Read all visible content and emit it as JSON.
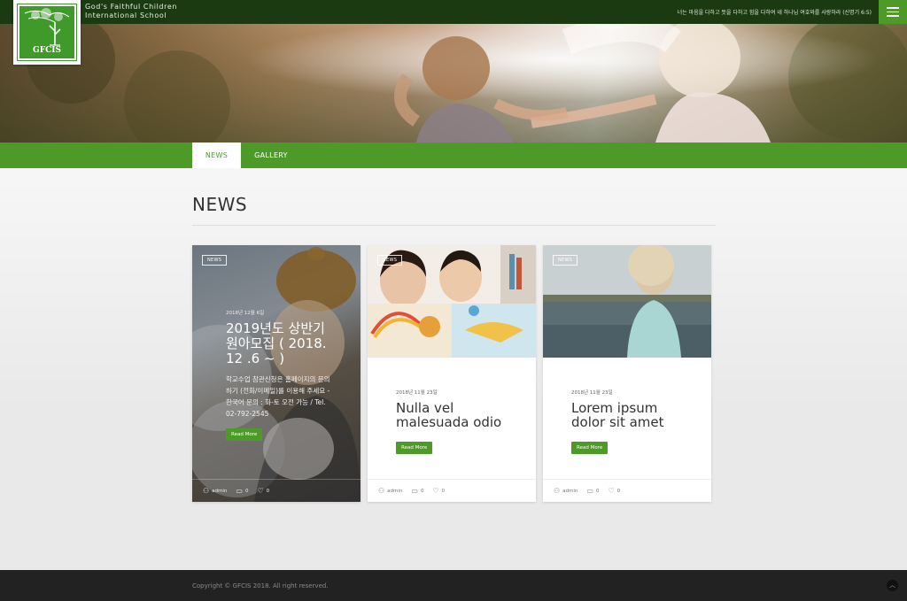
{
  "header": {
    "school_name_line1": "God's Faithful Children",
    "school_name_line2": "International School",
    "verse": "너는 마음을 다하고 뜻을 다하고 힘을 다하여 네 하나님 여호와를 사랑하라 (신명기 6:5)",
    "logo_text": "GFCIS",
    "menu_icon": "hamburger-icon"
  },
  "tabs": [
    {
      "label": "NEWS",
      "active": true
    },
    {
      "label": "GALLERY",
      "active": false
    }
  ],
  "section_title": "NEWS",
  "posts": [
    {
      "badge": "NEWS",
      "date": "2018년 12월 6일",
      "title": "2019년도 상반기 원아모집 ( 2018. 12 .6 ~ )",
      "excerpt": "학교수업 참관신청은 홈페이지의 문의하기 (전화/이메일)를 이용해 주세요 - 한국어 문의 : 화-토 오전 가능 / Tel. 02-792-2545",
      "read_more": "Read More",
      "author": "admin",
      "comments": "0",
      "likes": "0"
    },
    {
      "badge": "NEWS",
      "date": "2018년 11월 23일",
      "title": "Nulla vel malesuada odio",
      "read_more": "Read More",
      "author": "admin",
      "comments": "0",
      "likes": "0"
    },
    {
      "badge": "NEWS",
      "date": "2018년 11월 23일",
      "title": "Lorem ipsum dolor sit amet",
      "read_more": "Read More",
      "author": "admin",
      "comments": "0",
      "likes": "0"
    }
  ],
  "footer": {
    "copyright": "Copyright © GFCIS 2018. All right reserved.",
    "to_top_icon": "chevron-up-icon"
  },
  "colors": {
    "brand_green": "#4d9a28",
    "topbar": "#1b3a12",
    "footer": "#222222"
  }
}
